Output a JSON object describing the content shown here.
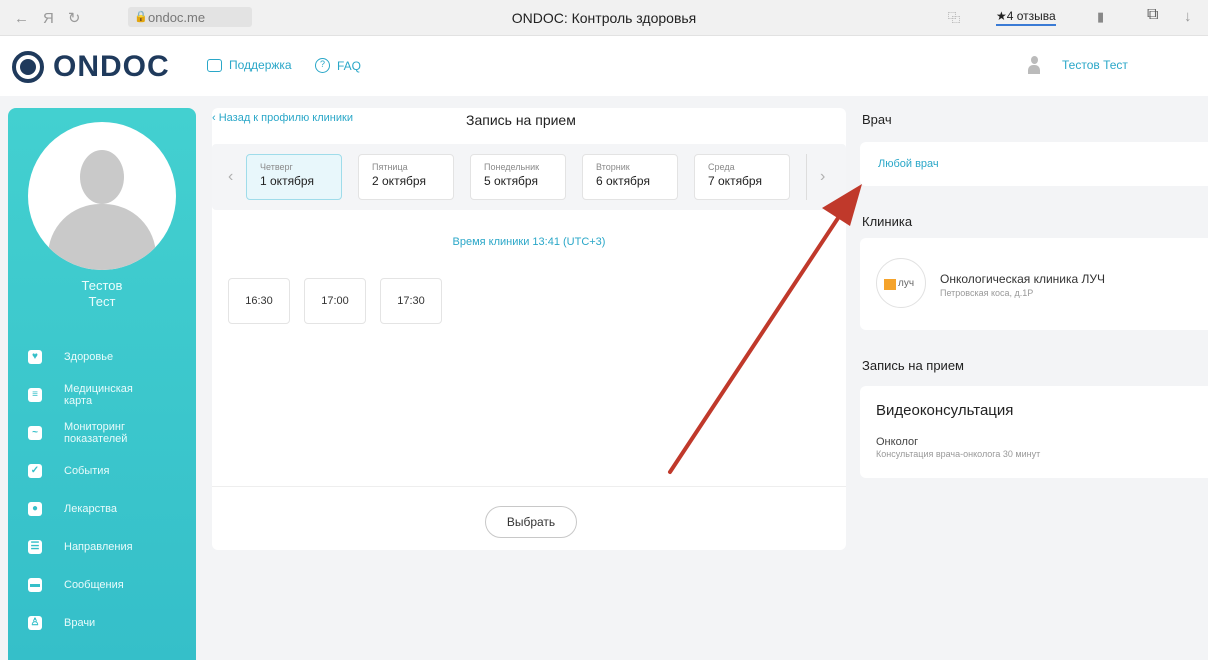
{
  "browser": {
    "url": "ondoc.me",
    "title": "ONDOC: Контроль здоровья",
    "reviews": "★4 отзыва"
  },
  "header": {
    "logo_text": "ONDOC",
    "support_label": "Поддержка",
    "faq_label": "FAQ",
    "user_name": "Тестов Тест"
  },
  "sidebar": {
    "first_name": "Тестов",
    "last_name": "Тест",
    "items": [
      {
        "label": "Здоровье",
        "icon": "heart-icon"
      },
      {
        "label": "Медицинская карта",
        "icon": "medical-card-icon"
      },
      {
        "label": "Мониторинг показателей",
        "icon": "chart-icon"
      },
      {
        "label": "События",
        "icon": "calendar-icon"
      },
      {
        "label": "Лекарства",
        "icon": "pills-icon"
      },
      {
        "label": "Направления",
        "icon": "clipboard-icon"
      },
      {
        "label": "Сообщения",
        "icon": "chat-icon"
      },
      {
        "label": "Врачи",
        "icon": "doctor-icon"
      }
    ]
  },
  "booking": {
    "back_label": "Назад к профилю клиники",
    "title": "Запись на прием",
    "days": [
      {
        "dow": "Четверг",
        "date": "1 октября"
      },
      {
        "dow": "Пятница",
        "date": "2 октября"
      },
      {
        "dow": "Понедельник",
        "date": "5 октября"
      },
      {
        "dow": "Вторник",
        "date": "6 октября"
      },
      {
        "dow": "Среда",
        "date": "7 октября"
      }
    ],
    "clinic_time": "Время клиники 13:41 (UTC+3)",
    "slots": [
      "16:30",
      "17:00",
      "17:30"
    ],
    "select_label": "Выбрать"
  },
  "right": {
    "doctor_title": "Врач",
    "any_doctor": "Любой врач",
    "clinic_title": "Клиника",
    "clinic_logo_text": "луч",
    "clinic_name": "Онкологическая клиника ЛУЧ",
    "clinic_address": "Петровская коса, д.1Р",
    "appointment_title": "Запись на прием",
    "consult_type": "Видеоконсультация",
    "specialty": "Онколог",
    "consult_desc": "Консультация врача-онколога 30 минут"
  },
  "colors": {
    "accent": "#2aa7c8",
    "sidebar": "#3fc9cc",
    "logo": "#1f3a5c",
    "annotation_arrow": "#c0392b"
  }
}
